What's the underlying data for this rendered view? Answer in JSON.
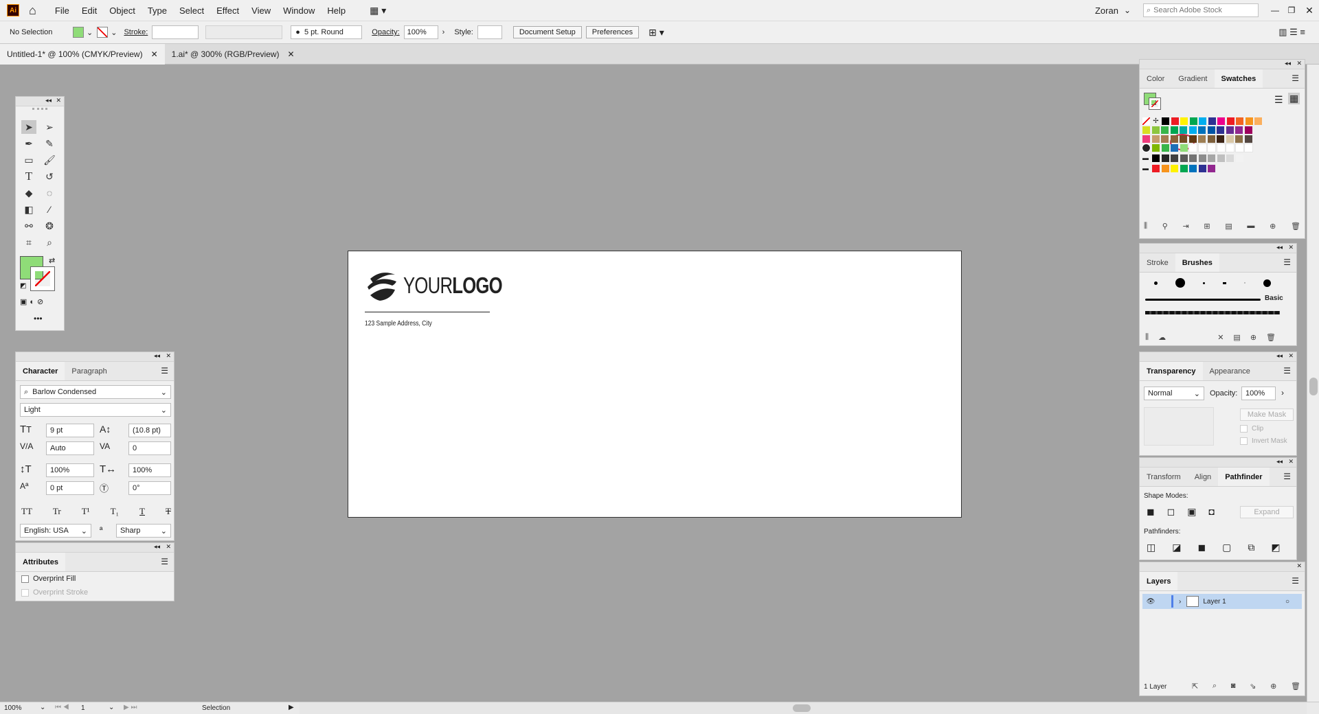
{
  "menubar": {
    "app_icon": "Ai",
    "items": [
      "File",
      "Edit",
      "Object",
      "Type",
      "Select",
      "Effect",
      "View",
      "Window",
      "Help"
    ],
    "user": "Zoran",
    "search_placeholder": "Search Adobe Stock"
  },
  "options": {
    "selection": "No Selection",
    "stroke_label": "Stroke:",
    "brush": "5 pt. Round",
    "opacity_label": "Opacity:",
    "opacity_value": "100%",
    "style_label": "Style:",
    "doc_setup": "Document Setup",
    "preferences": "Preferences",
    "fill_color": "#8fdc78"
  },
  "doc_tabs": [
    {
      "label": "Untitled-1* @ 100% (CMYK/Preview)",
      "active": true
    },
    {
      "label": "1.ai* @ 300% (RGB/Preview)",
      "active": false
    }
  ],
  "artboard": {
    "logo_light": "YOUR",
    "logo_bold": "LOGO",
    "address": "123 Sample Address, City"
  },
  "character": {
    "tabs": [
      "Character",
      "Paragraph"
    ],
    "font": "Barlow Condensed",
    "weight": "Light",
    "size": "9 pt",
    "leading": "(10.8 pt)",
    "kerning": "Auto",
    "tracking": "0",
    "vscale": "100%",
    "hscale": "100%",
    "baseline": "0 pt",
    "rotation": "0°",
    "language": "English: USA",
    "aa": "Sharp",
    "style_buttons": [
      "TT",
      "Tr",
      "T¹",
      "T₁",
      "T",
      "T"
    ]
  },
  "attributes": {
    "title": "Attributes",
    "overprint_fill": "Overprint Fill",
    "overprint_stroke": "Overprint Stroke"
  },
  "swatches": {
    "tabs": [
      "Color",
      "Gradient",
      "Swatches"
    ],
    "row1": [
      "#000000",
      "#ed1c24",
      "#fff200",
      "#00a651",
      "#00aeef",
      "#2e3192",
      "#ec008c",
      "#ed1c24",
      "#f26522",
      "#f7941d",
      "#fbaf5d"
    ],
    "row2": [
      "#d7df23",
      "#8dc63f",
      "#39b54a",
      "#00a651",
      "#00a99d",
      "#00aeef",
      "#0072bc",
      "#0054a6",
      "#2e3192",
      "#662d91",
      "#92278f",
      "#9e005d"
    ],
    "row3": [
      "#ee3c7c",
      "#c69c6d",
      "#a67c52",
      "#8c6239",
      "#754c24",
      "#603913",
      "#9e7f54",
      "#7d5f3b",
      "#3c2415",
      "#d9c7a7",
      "#8b6f47",
      "#534741"
    ],
    "row4": [
      "#7fb800",
      "#39b54a",
      "#1d6fb8",
      "#8fdc78",
      "#ffffff",
      "#ffffff",
      "#ffffff",
      "#ffffff",
      "#ffffff",
      "#ffffff",
      "#ffffff"
    ],
    "grays": [
      "#000000",
      "#262626",
      "#404040",
      "#595959",
      "#737373",
      "#8c8c8c",
      "#a6a6a6",
      "#bfbfbf",
      "#d9d9d9",
      "#f2f2f2"
    ],
    "brights": [
      "#ed1c24",
      "#f7941d",
      "#fff200",
      "#00a651",
      "#0072bc",
      "#2e3192",
      "#92278f"
    ]
  },
  "brushes": {
    "tabs": [
      "Stroke",
      "Brushes"
    ],
    "basic": "Basic"
  },
  "transparency": {
    "tabs": [
      "Transparency",
      "Appearance"
    ],
    "mode": "Normal",
    "opacity_label": "Opacity:",
    "opacity": "100%",
    "make_mask": "Make Mask",
    "clip": "Clip",
    "invert": "Invert Mask"
  },
  "pathfinder": {
    "tabs": [
      "Transform",
      "Align",
      "Pathfinder"
    ],
    "shape_modes": "Shape Modes:",
    "expand": "Expand",
    "pathfinders": "Pathfinders:"
  },
  "layers": {
    "title": "Layers",
    "layer_name": "Layer 1",
    "count": "1 Layer"
  },
  "status": {
    "zoom": "100%",
    "artboard": "1",
    "tool": "Selection"
  }
}
